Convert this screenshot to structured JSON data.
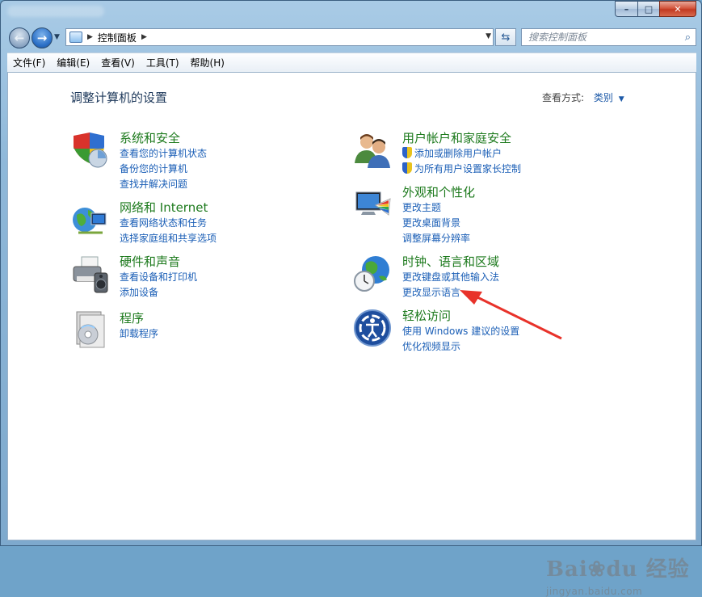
{
  "window": {
    "buttons": {
      "minimize": "–",
      "maximize": "□",
      "close": "✕"
    }
  },
  "navigation": {
    "back_icon": "←",
    "forward_icon": "→",
    "dropdown_icon": "▼",
    "breadcrumb": "控制面板",
    "refresh_icon": "⇆",
    "search_placeholder": "搜索控制面板",
    "search_icon": "⌕"
  },
  "menubar": {
    "items": [
      "文件(F)",
      "编辑(E)",
      "查看(V)",
      "工具(T)",
      "帮助(H)"
    ]
  },
  "main": {
    "heading": "调整计算机的设置",
    "view_by_label": "查看方式:",
    "view_by_value": "类别",
    "left_categories": [
      {
        "title": "系统和安全",
        "links": [
          "查看您的计算机状态",
          "备份您的计算机",
          "查找并解决问题"
        ],
        "icon": "security-shield-icon"
      },
      {
        "title": "网络和 Internet",
        "links": [
          "查看网络状态和任务",
          "选择家庭组和共享选项"
        ],
        "icon": "network-globe-icon"
      },
      {
        "title": "硬件和声音",
        "links": [
          "查看设备和打印机",
          "添加设备"
        ],
        "icon": "printer-speaker-icon"
      },
      {
        "title": "程序",
        "links": [
          "卸载程序"
        ],
        "icon": "programs-disc-icon"
      }
    ],
    "right_categories": [
      {
        "title": "用户帐户和家庭安全",
        "links": [
          "添加或删除用户帐户",
          "为所有用户设置家长控制"
        ],
        "icon": "users-icon"
      },
      {
        "title": "外观和个性化",
        "links": [
          "更改主题",
          "更改桌面背景",
          "调整屏幕分辨率"
        ],
        "icon": "monitor-palette-icon"
      },
      {
        "title": "时钟、语言和区域",
        "links": [
          "更改键盘或其他输入法",
          "更改显示语言"
        ],
        "icon": "clock-globe-icon"
      },
      {
        "title": "轻松访问",
        "links": [
          "使用 Windows 建议的设置",
          "优化视频显示"
        ],
        "icon": "ease-of-access-icon"
      }
    ]
  },
  "watermark": {
    "brand": "Bai❀du 经验",
    "url": "jingyan.baidu.com"
  },
  "colors": {
    "category_title": "#1d7a1d",
    "link": "#1a5eb6",
    "heading": "#1e395b",
    "annotation_arrow": "#e8322a"
  }
}
